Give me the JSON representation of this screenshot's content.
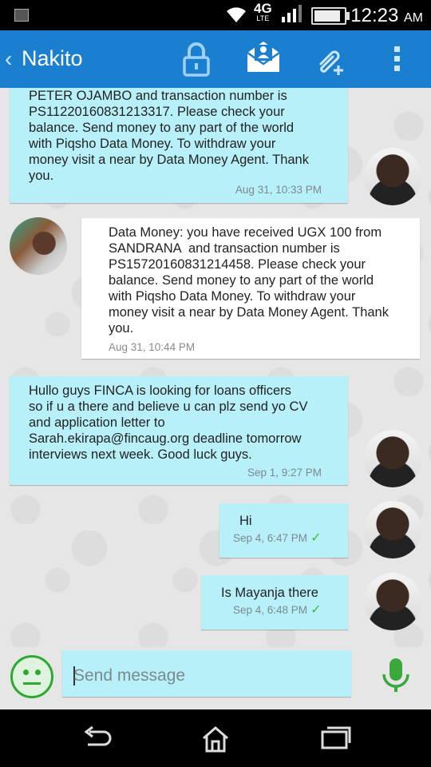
{
  "status_bar": {
    "time": "12:23",
    "ampm": "AM",
    "network": "4G",
    "network_sub": "LTE",
    "battery_level": 0.95
  },
  "app_bar": {
    "title": "Nakito"
  },
  "messages": [
    {
      "direction": "out",
      "text": "PETER OJAMBO and transaction number is\nPS11220160831213317. Please check your\nbalance. Send money to any part of the world\nwith Piqsho Data Money. To withdraw your\nmoney visit a near by Data Money Agent. Thank\nyou.",
      "time": "Aug 31, 10:33 PM"
    },
    {
      "direction": "in",
      "text": "Data Money: you have received UGX 100 from\nSANDRANA  and transaction number is\nPS15720160831214458. Please check your\nbalance. Send money to any part of the world\nwith Piqsho Data Money. To withdraw your\nmoney visit a near by Data Money Agent. Thank\nyou.",
      "time": "Aug 31, 10:44 PM"
    },
    {
      "direction": "out",
      "text": "Hullo guys FINCA is looking for loans officers\nso if u a there and believe u can plz send yo CV\nand application letter to\nSarah.ekirapa@fincaug.org deadline tomorrow\ninterviews next week. Good luck guys.",
      "time": "Sep 1, 9:27 PM"
    },
    {
      "direction": "out",
      "text": "Hi",
      "time": "Sep 4, 6:47 PM",
      "check": "✓"
    },
    {
      "direction": "out",
      "text": "Is Mayanja there",
      "time": "Sep 4, 6:48 PM",
      "check": "✓"
    }
  ],
  "composer": {
    "placeholder": "Send message"
  },
  "colors": {
    "app_bar": "#1b7fd0",
    "outgoing_bubble": "#b8f0fa",
    "incoming_bubble": "#ffffff",
    "check": "#3cbf3c",
    "emoji": "#2fa82f"
  },
  "icons": [
    "image-icon",
    "wifi-icon",
    "signal-icon",
    "battery-icon",
    "back-chevron-icon",
    "lock-icon",
    "envelope-contact-icon",
    "attach-plus-icon",
    "overflow-menu-icon",
    "emoji-icon",
    "microphone-icon",
    "back-nav-icon",
    "home-nav-icon",
    "recents-nav-icon"
  ]
}
